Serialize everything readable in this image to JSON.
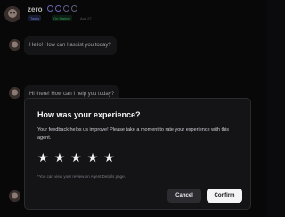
{
  "agent": {
    "name": "zero",
    "tasks_chip": "Tasks",
    "status_chip": "On Market",
    "date_chip": "Aug 27"
  },
  "chat": {
    "messages": [
      "Hello! How can I assist you today?",
      "Hi there! How can I help you today?"
    ]
  },
  "modal": {
    "title": "How was your experience?",
    "description": "Your feedback helps us improve! Please take a moment to rate your experience with this agent.",
    "rating_max": 5,
    "rating_value": 0,
    "star_glyph": "★",
    "note": "*You can view your review on Agent Details page.",
    "cancel_label": "Cancel",
    "confirm_label": "Confirm"
  }
}
